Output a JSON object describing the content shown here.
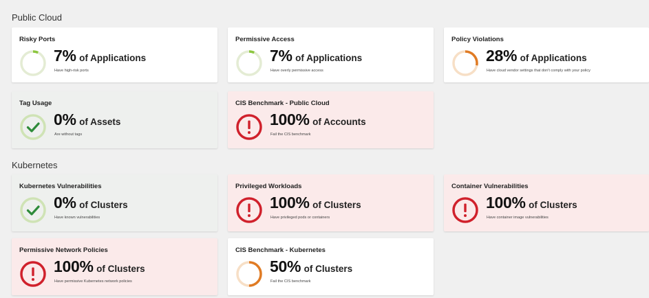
{
  "sections": {
    "public_cloud": "Public Cloud",
    "kubernetes": "Kubernetes"
  },
  "colors": {
    "ring_track": "#e4ecd4",
    "progress_green": "#8cc63f",
    "progress_orange": "#e07b24",
    "ring_orange_track": "#f7dfc6",
    "check_ring": "#cfe3b5",
    "check_mark": "#2e8b3a",
    "alert_red": "#d0212c"
  },
  "cards": {
    "risky_ports": {
      "title": "Risky Ports",
      "percent": "7%",
      "unit": "of Applications",
      "subtitle": "Have high-risk ports",
      "value": 0.07,
      "icon": "progress-ring-icon"
    },
    "permissive_access": {
      "title": "Permissive Access",
      "percent": "7%",
      "unit": "of Applications",
      "subtitle": "Have overly permissive access",
      "value": 0.07,
      "icon": "progress-ring-icon"
    },
    "policy_violations": {
      "title": "Policy Violations",
      "percent": "28%",
      "unit": "of Applications",
      "subtitle": "Have cloud vendor settings that don't comply with your policy",
      "value": 0.28,
      "icon": "progress-ring-icon"
    },
    "tag_usage": {
      "title": "Tag Usage",
      "percent": "0%",
      "unit": "of Assets",
      "subtitle": "Are without tags",
      "icon": "checkmark-icon"
    },
    "cis_public_cloud": {
      "title": "CIS Benchmark - Public Cloud",
      "percent": "100%",
      "unit": "of Accounts",
      "subtitle": "Fail the CIS benchmark",
      "icon": "alert-icon"
    },
    "kube_vulns": {
      "title": "Kubernetes Vulnerabilities",
      "percent": "0%",
      "unit": "of Clusters",
      "subtitle": "Have known vulnerabilities",
      "icon": "checkmark-icon"
    },
    "privileged_workloads": {
      "title": "Privileged Workloads",
      "percent": "100%",
      "unit": "of Clusters",
      "subtitle": "Have privileged pods or containers",
      "icon": "alert-icon"
    },
    "container_vulns": {
      "title": "Container Vulnerabilities",
      "percent": "100%",
      "unit": "of Clusters",
      "subtitle": "Have container image vulnerabilities",
      "icon": "alert-icon"
    },
    "permissive_network": {
      "title": "Permissive Network Policies",
      "percent": "100%",
      "unit": "of Clusters",
      "subtitle": "Have permissive Kubernetes network policies",
      "icon": "alert-icon"
    },
    "cis_kubernetes": {
      "title": "CIS Benchmark - Kubernetes",
      "percent": "50%",
      "unit": "of Clusters",
      "subtitle": "Fail the CIS benchmark",
      "value": 0.5,
      "icon": "progress-ring-icon"
    }
  }
}
